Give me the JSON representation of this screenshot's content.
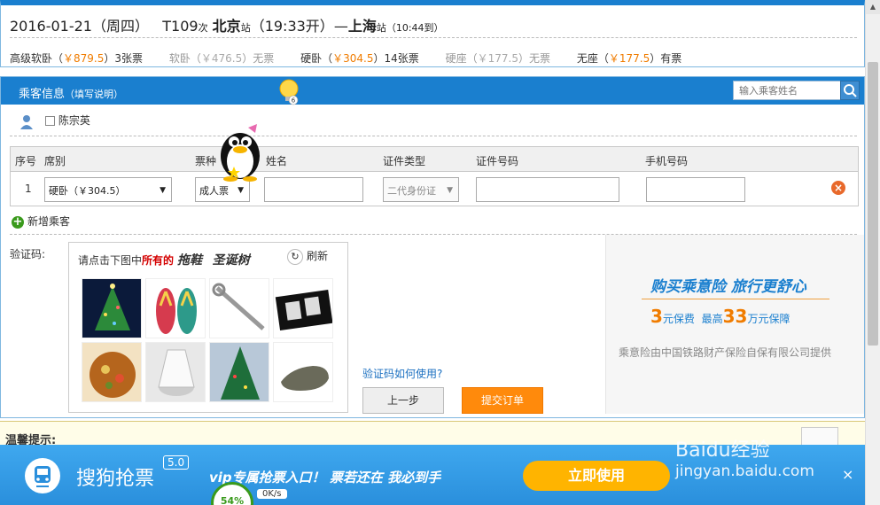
{
  "train": {
    "date": "2016-01-21（周四）",
    "train_no": "T109",
    "train_suffix": "次",
    "from": "北京",
    "from_suffix": "站",
    "depart": "（19:33开）",
    "dash": "—",
    "to": "上海",
    "to_suffix": "站",
    "arrive": "（10:44到）"
  },
  "seats": [
    {
      "name": "高级软卧（",
      "price": "￥879.5",
      "close": "）",
      "avail": "3张票",
      "available": true
    },
    {
      "name": "软卧（",
      "price": "￥476.5",
      "close": "）",
      "avail": "无票",
      "available": false
    },
    {
      "name": "硬卧（",
      "price": "￥304.5",
      "close": "）",
      "avail": "14张票",
      "available": true
    },
    {
      "name": "硬座（",
      "price": "￥177.5",
      "close": "）",
      "avail": "无票",
      "available": false
    },
    {
      "name": "无座（",
      "price": "￥177.5",
      "close": "）",
      "avail": "有票",
      "available": true
    }
  ],
  "passenger": {
    "header": "乘客信息",
    "header_help": "（填写说明）",
    "bulb_count": "6",
    "search_placeholder": "输入乘客姓名",
    "contact_name": "陈宗英",
    "columns": {
      "no": "序号",
      "seat": "席别",
      "ticket": "票种",
      "name": "姓名",
      "id_type": "证件类型",
      "id_no": "证件号码",
      "phone": "手机号码"
    },
    "row": {
      "no": "1",
      "seat": "硬卧（￥304.5）",
      "ticket": "成人票",
      "name": "",
      "id_type": "二代身份证",
      "id_no": "",
      "phone": ""
    },
    "add_label": "新增乘客"
  },
  "captcha": {
    "label": "验证码:",
    "prompt_pre": "请点击下图中",
    "prompt_red": "所有的",
    "target1": "拖鞋",
    "target2": "圣诞树",
    "refresh": "刷新",
    "help_link": "验证码如何使用?",
    "prev_button": "上一步",
    "submit_button": "提交订单"
  },
  "insurance": {
    "title": "购买乘意险  旅行更舒心",
    "price_num": "3",
    "price_txt": "元保费",
    "max_pre": "最高",
    "max_num": "33",
    "max_txt": "万元保障",
    "provider": "乘意险由中国铁路财产保险自保有限公司提供"
  },
  "tips": {
    "label": "温馨提示:"
  },
  "ad": {
    "name": "搜狗抢票",
    "version": "5.0",
    "slogan": "vip专属抢票入口！  票若还在 我必到手",
    "button": "立即使用",
    "close": "×",
    "speed_percent": "54%",
    "speed_rate": "0K/s"
  },
  "watermark": {
    "brand": "Baidu经验",
    "site": "jingyan.baidu.com"
  }
}
